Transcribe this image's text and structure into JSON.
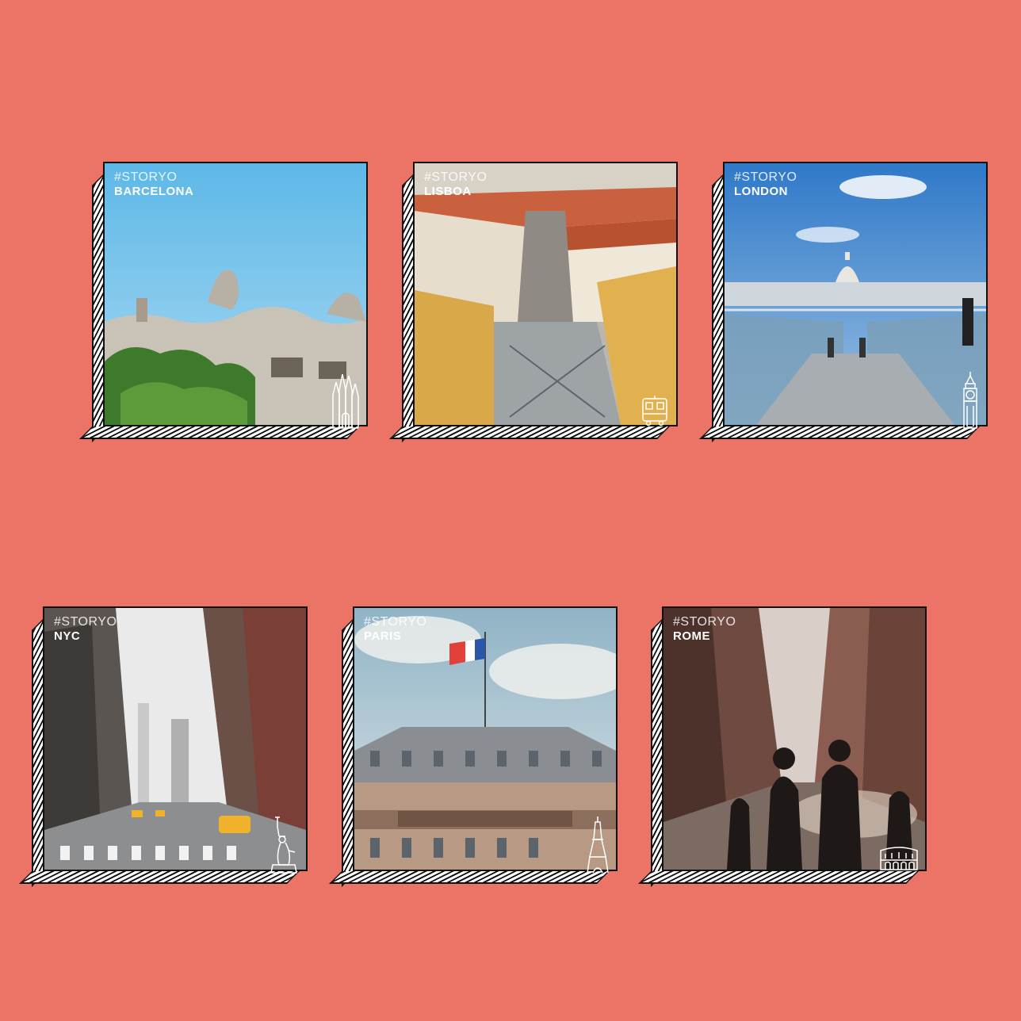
{
  "hashtag": "#STORYO",
  "cards": [
    {
      "city": "BARCELONA",
      "icon": "sagrada-familia-icon"
    },
    {
      "city": "LISBOA",
      "icon": "tram-icon"
    },
    {
      "city": "LONDON",
      "icon": "big-ben-icon"
    },
    {
      "city": "NYC",
      "icon": "statue-of-liberty-icon"
    },
    {
      "city": "PARIS",
      "icon": "eiffel-tower-icon"
    },
    {
      "city": "ROME",
      "icon": "colosseum-icon"
    }
  ],
  "colors": {
    "background": "#ec7467",
    "frame": "#111111"
  }
}
